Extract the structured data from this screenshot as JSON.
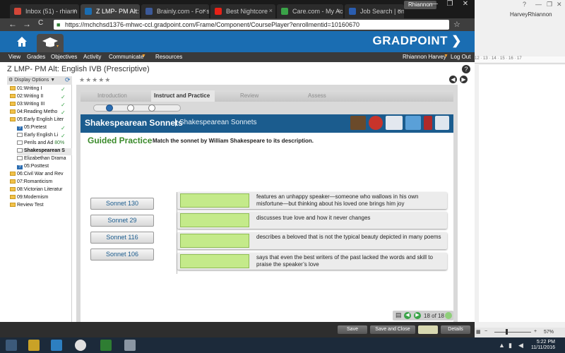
{
  "browser": {
    "tabs": [
      {
        "label": "Inbox (51) - rhiann",
        "color": "#d44638"
      },
      {
        "label": "Z LMP- PM Alt: Engl",
        "color": "#1a6db2"
      },
      {
        "label": "Brainly.com - For st",
        "color": "#3b5998"
      },
      {
        "label": "Best Nightcore",
        "color": "#e62117"
      },
      {
        "label": "Care.com - My Acco",
        "color": "#3aa348"
      },
      {
        "label": "Job Search | one se",
        "color": "#2a5db0"
      }
    ],
    "tab_close": "×",
    "user_chip": "Rhiannon",
    "url": "https://mchchsd1376-mhwc-ccl.gradpoint.com/Frame/Component/CoursePlayer?enrollmentid=10160670",
    "nav": {
      "back": "←",
      "forward": "→",
      "reload": "C",
      "star": "☆"
    }
  },
  "app": {
    "logo": "GRADPOINT",
    "menu": [
      "View",
      "Grades",
      "Objectives",
      "Activity",
      "Communicate",
      "Resources"
    ],
    "user_name": "Rhiannon Harvey",
    "logout": "Log Out",
    "course_title": "Z LMP- PM Alt: English IVB (Prescriptive)",
    "help": "?",
    "display_options": "Display Options",
    "refresh": "⟳",
    "stars": "★★★★★",
    "page_prev": "◀",
    "page_next": "▶"
  },
  "sidebar": {
    "items": [
      {
        "label": "01:Writing I",
        "type": "folder",
        "check": true,
        "indent": 0
      },
      {
        "label": "02:Writing II",
        "type": "folder",
        "check": true,
        "indent": 0
      },
      {
        "label": "03:Writing III",
        "type": "folder",
        "check": true,
        "indent": 0
      },
      {
        "label": "04:Reading Metho",
        "type": "folder",
        "check": true,
        "indent": 0
      },
      {
        "label": "05:Early English Liter",
        "type": "folder",
        "check": false,
        "indent": 0
      },
      {
        "label": "05:Pretest",
        "type": "quiz",
        "check": true,
        "indent": 1
      },
      {
        "label": "Early English Li",
        "type": "doc",
        "check": true,
        "indent": 1
      },
      {
        "label": "Perils and Ad",
        "type": "doc",
        "check": false,
        "indent": 1,
        "pct": "80%"
      },
      {
        "label": "Shakespearean S",
        "type": "doc",
        "check": false,
        "indent": 1,
        "selected": true
      },
      {
        "label": "Elizabethan Drama",
        "type": "doc",
        "check": false,
        "indent": 1
      },
      {
        "label": "05:Posttest",
        "type": "quiz",
        "check": false,
        "indent": 1
      },
      {
        "label": "06:Civil War and Rev",
        "type": "folder",
        "check": false,
        "indent": 0
      },
      {
        "label": "07:Romanticism",
        "type": "folder",
        "check": false,
        "indent": 0
      },
      {
        "label": "08:Victorian Literatur",
        "type": "folder",
        "check": false,
        "indent": 0
      },
      {
        "label": "09:Modernism",
        "type": "folder",
        "check": false,
        "indent": 0
      },
      {
        "label": "Review Test",
        "type": "folder",
        "check": false,
        "indent": 0
      }
    ],
    "check_glyph": "✓"
  },
  "lesson": {
    "phases": [
      "Introduction",
      "Instruct and Practice",
      "Review",
      "Assess"
    ],
    "active_phase": 1,
    "banner_title": "Shakespearean Sonnets",
    "banner_sub": "Shakespearean Sonnets",
    "heading": "Guided Practice",
    "instruction": "Match the sonnet by William Shakespeare to its description.",
    "sonnets": [
      "Sonnet 130",
      "Sonnet 29",
      "Sonnet 116",
      "Sonnet 106"
    ],
    "descriptions": [
      "features an unhappy speaker—someone who wallows in his own misfortune—but thinking about his loved one brings him joy",
      "discusses true love and how it never changes",
      "describes a beloved that is not the typical beauty depicted in many poems",
      "says that even the best writers of the past lacked the words and skill to praise the speaker’s love"
    ],
    "pager_text": "18 of 18",
    "pager_prev": "◀",
    "pager_next": "▶"
  },
  "footer": {
    "save": "Save",
    "save_close": "Save and Close",
    "details": "Details"
  },
  "word": {
    "user": "HarveyRhiannon",
    "ruler_marks": "12 · 13 · 14 · 15 · 16 · 17",
    "zoom": "57%",
    "help": "?",
    "minimize": "—",
    "restore": "❐",
    "close": "✕"
  },
  "taskbar": {
    "time": "5:22 PM",
    "date": "11/11/2016"
  }
}
